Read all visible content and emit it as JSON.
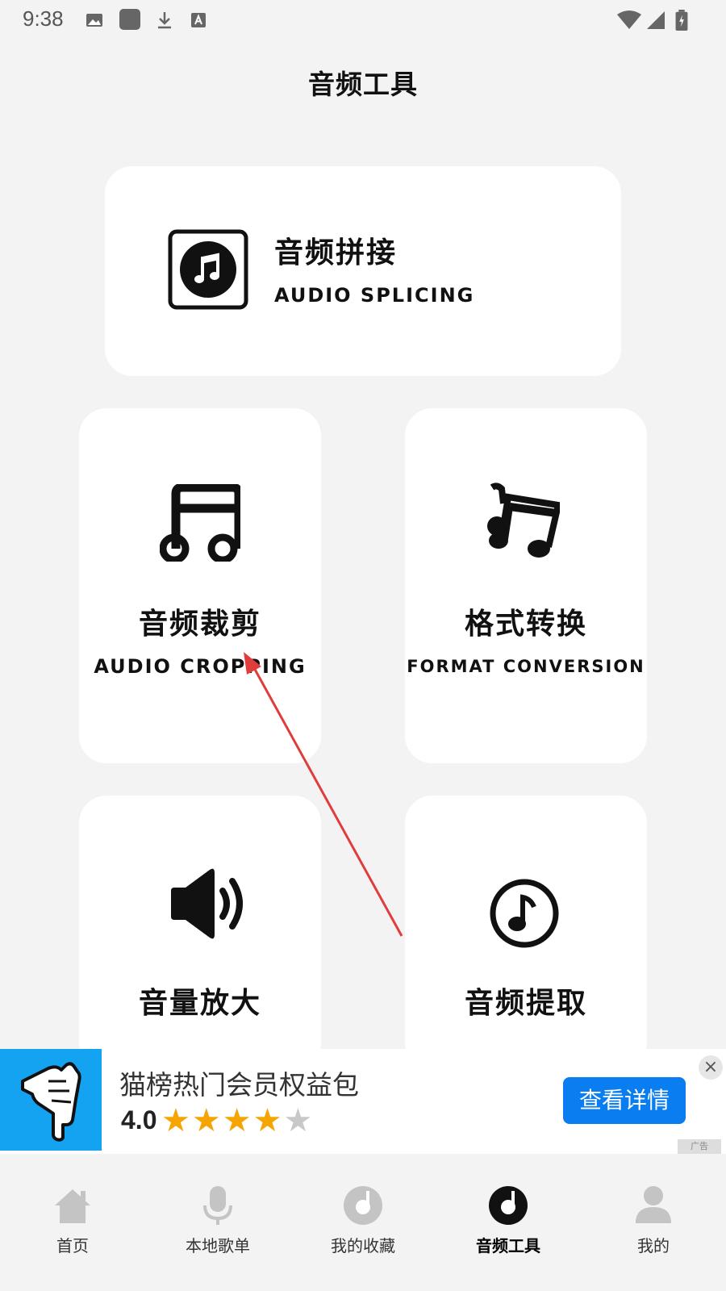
{
  "status_bar": {
    "time": "9:38"
  },
  "page": {
    "title": "音频工具"
  },
  "tools": {
    "splicing": {
      "title_zh": "音频拼接",
      "title_en": "AUDIO SPLICING"
    },
    "cropping": {
      "title_zh": "音频裁剪",
      "title_en": "AUDIO CROPPING"
    },
    "convert": {
      "title_zh": "格式转换",
      "title_en": "FORMAT CONVERSION"
    },
    "amplify": {
      "title_zh": "音量放大"
    },
    "extract": {
      "title_zh": "音频提取"
    }
  },
  "ad": {
    "title": "猫榜热门会员权益包",
    "rating": "4.0",
    "stars_filled": 4,
    "stars_total": 5,
    "cta_label": "查看详情",
    "close_icon": "×",
    "tag": "广告"
  },
  "nav": {
    "items": [
      {
        "label": "首页"
      },
      {
        "label": "本地歌单"
      },
      {
        "label": "我的收藏"
      },
      {
        "label": "音频工具"
      },
      {
        "label": "我的"
      }
    ],
    "active_index": 3
  },
  "colors": {
    "background": "#f3f3f3",
    "card": "#ffffff",
    "ad_button": "#0a7df0",
    "star": "#f5a400",
    "annotation_arrow": "#e03c3c"
  }
}
